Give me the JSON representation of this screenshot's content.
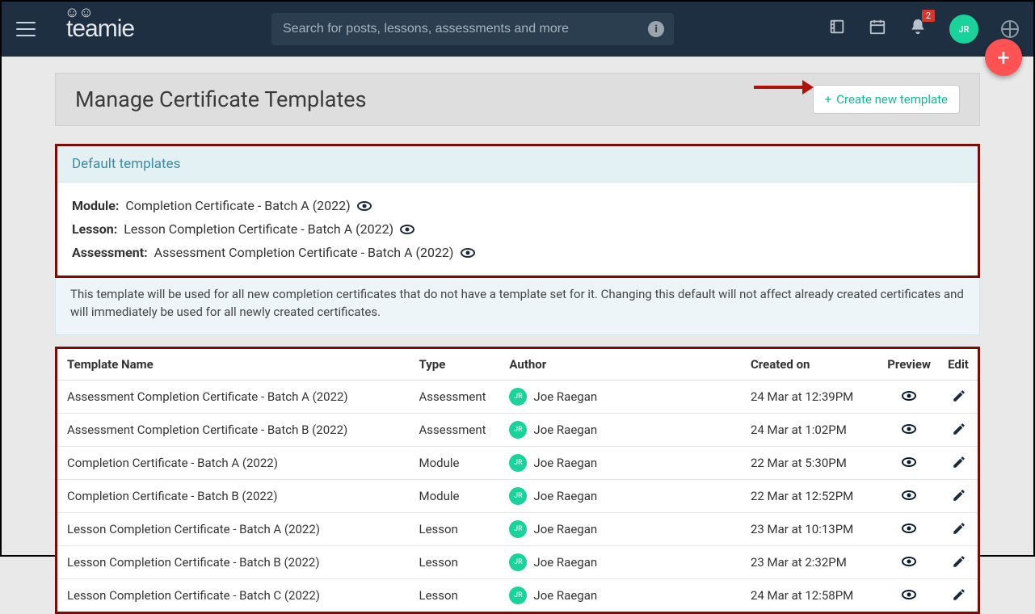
{
  "header": {
    "search_placeholder": "Search for posts, lessons, assessments and more",
    "notification_count": "2",
    "avatar_initials": "JR"
  },
  "page": {
    "title": "Manage Certificate Templates",
    "create_button": "Create new template"
  },
  "default_section": {
    "heading": "Default templates",
    "module_label": "Module:",
    "module_value": "Completion Certificate - Batch A (2022)",
    "lesson_label": "Lesson:",
    "lesson_value": "Lesson Completion Certificate - Batch A (2022)",
    "assessment_label": "Assessment:",
    "assessment_value": "Assessment Completion Certificate - Batch A (2022)",
    "description": "This template will be used for all new completion certificates that do not have a template set for it. Changing this default will not affect already created certificates and will immediately be used for all newly created certificates."
  },
  "columns": {
    "name": "Template Name",
    "type": "Type",
    "author": "Author",
    "created": "Created on",
    "preview": "Preview",
    "edit": "Edit"
  },
  "rows": [
    {
      "name": "Assessment Completion Certificate - Batch A (2022)",
      "type": "Assessment",
      "author": "Joe Raegan",
      "created": "24 Mar at 12:39PM"
    },
    {
      "name": "Assessment Completion Certificate - Batch B (2022)",
      "type": "Assessment",
      "author": "Joe Raegan",
      "created": "24 Mar at 1:02PM"
    },
    {
      "name": "Completion Certificate - Batch A (2022)",
      "type": "Module",
      "author": "Joe Raegan",
      "created": "22 Mar at 5:30PM"
    },
    {
      "name": "Completion Certificate - Batch B (2022)",
      "type": "Module",
      "author": "Joe Raegan",
      "created": "22 Mar at 12:52PM"
    },
    {
      "name": "Lesson Completion Certificate - Batch A (2022)",
      "type": "Lesson",
      "author": "Joe Raegan",
      "created": "23 Mar at 10:13PM"
    },
    {
      "name": "Lesson Completion Certificate - Batch B (2022)",
      "type": "Lesson",
      "author": "Joe Raegan",
      "created": "23 Mar at 2:32PM"
    },
    {
      "name": "Lesson Completion Certificate - Batch C (2022)",
      "type": "Lesson",
      "author": "Joe Raegan",
      "created": "24 Mar at 12:58PM"
    }
  ]
}
